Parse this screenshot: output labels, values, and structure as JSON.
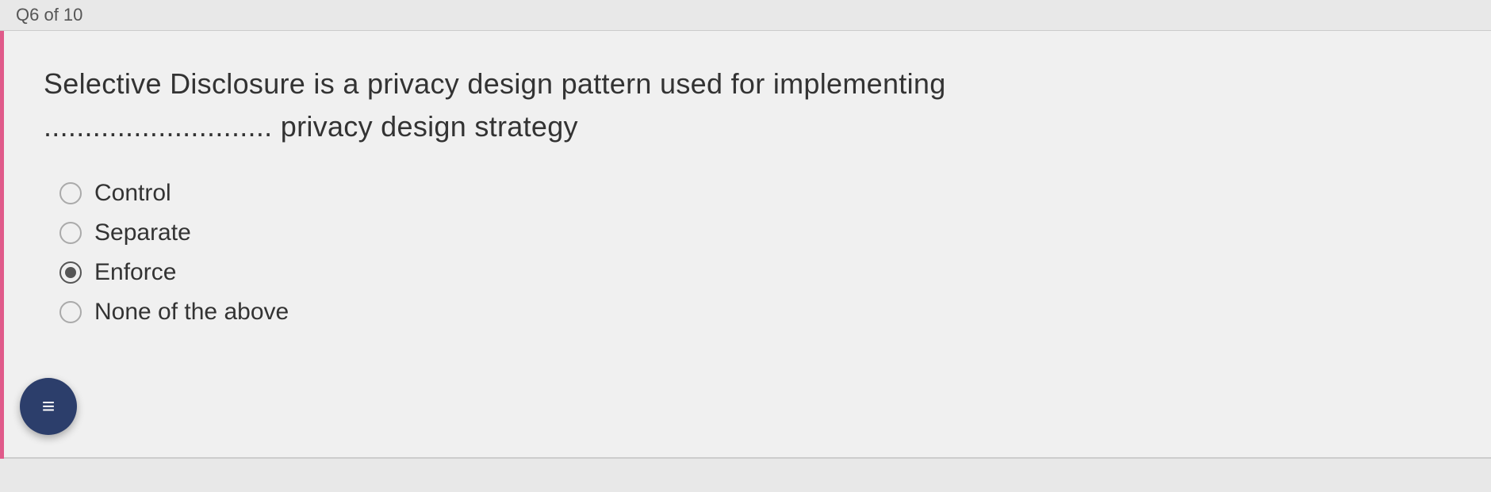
{
  "header": {
    "question_number": "Q6 of 10"
  },
  "question": {
    "text_part1": "Selective Disclosure is a privacy design pattern used for implementing",
    "text_part2": "............................ privacy design strategy"
  },
  "options": [
    {
      "id": "control",
      "label": "Control",
      "selected": false
    },
    {
      "id": "separate",
      "label": "Separate",
      "selected": false
    },
    {
      "id": "enforce",
      "label": "Enforce",
      "selected": true
    },
    {
      "id": "none",
      "label": "None of the above",
      "selected": false
    }
  ],
  "fab": {
    "icon": "≡",
    "aria_label": "Menu"
  },
  "colors": {
    "accent": "#e05a8a",
    "dark_blue": "#2c3e6b",
    "background": "#e8e8e8",
    "card_bg": "#f0f0f0"
  }
}
